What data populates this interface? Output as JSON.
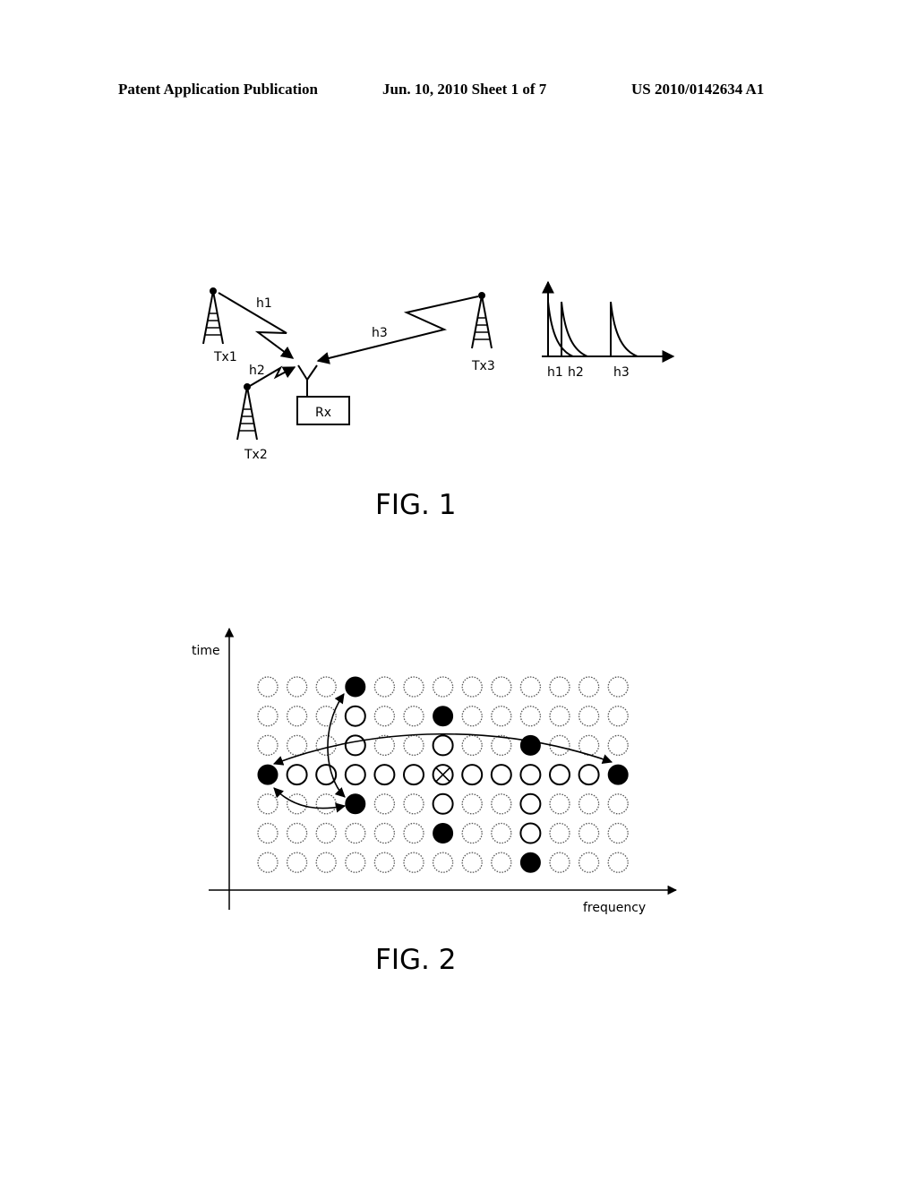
{
  "header": {
    "publication": "Patent Application Publication",
    "date_sheet": "Jun. 10, 2010  Sheet 1 of 7",
    "number": "US 2010/0142634 A1"
  },
  "fig1": {
    "caption": "FIG. 1",
    "transmitters": [
      "Tx1",
      "Tx2",
      "Tx3"
    ],
    "receiver": "Rx",
    "channels": [
      "h1",
      "h2",
      "h3"
    ],
    "impulse_labels": [
      "h1",
      "h2",
      "h3"
    ]
  },
  "fig2": {
    "caption": "FIG. 2",
    "y_axis_label": "time",
    "x_axis_label": "frequency",
    "grid": {
      "rows": 7,
      "cols": 13,
      "filled": [
        [
          0,
          3
        ],
        [
          1,
          6
        ],
        [
          2,
          9
        ],
        [
          3,
          0
        ],
        [
          3,
          12
        ],
        [
          4,
          3
        ],
        [
          5,
          6
        ],
        [
          6,
          9
        ]
      ],
      "solid_open": [
        [
          1,
          3
        ],
        [
          2,
          3
        ],
        [
          2,
          6
        ],
        [
          3,
          1
        ],
        [
          3,
          2
        ],
        [
          3,
          3
        ],
        [
          3,
          4
        ],
        [
          3,
          5
        ],
        [
          3,
          7
        ],
        [
          3,
          8
        ],
        [
          3,
          9
        ],
        [
          3,
          10
        ],
        [
          3,
          11
        ],
        [
          4,
          6
        ],
        [
          4,
          9
        ],
        [
          5,
          9
        ]
      ],
      "crossed": [
        [
          3,
          6
        ]
      ]
    }
  }
}
